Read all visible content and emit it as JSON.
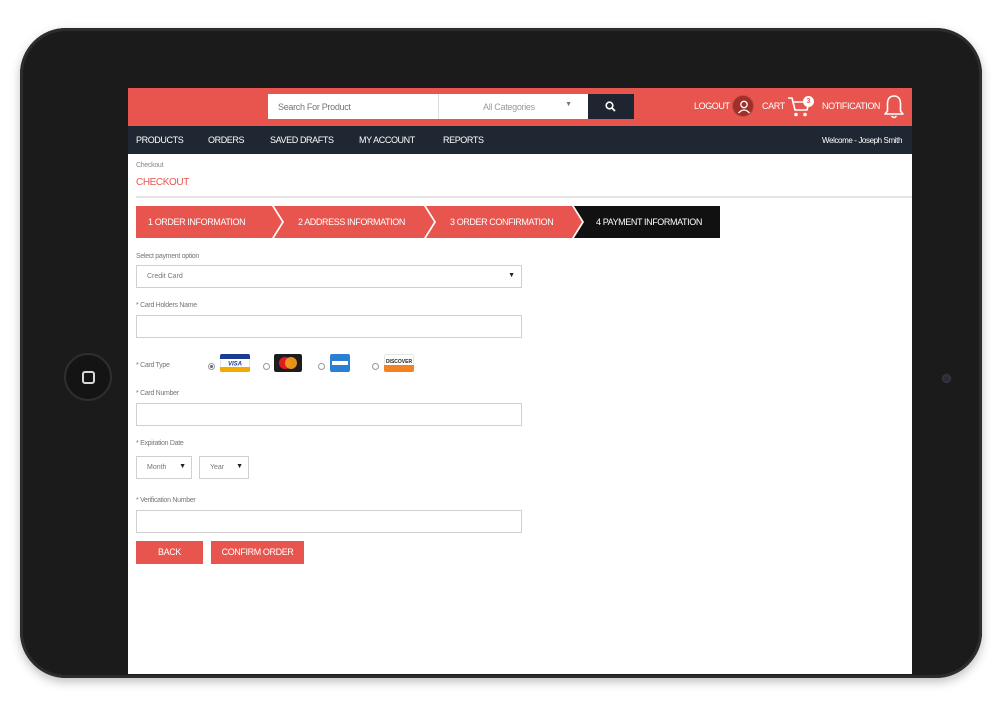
{
  "header": {
    "search_placeholder": "Search For Product",
    "category_label": "All Categories",
    "logout_label": "LOGOUT",
    "cart_label": "CART",
    "cart_count": "3",
    "notification_label": "NOTIFICATION"
  },
  "nav": {
    "items": [
      "PRODUCTS",
      "ORDERS",
      "SAVED DRAFTS",
      "MY ACCOUNT",
      "REPORTS"
    ],
    "welcome": "Welcome - Joseph Smith"
  },
  "breadcrumb": "Checkout",
  "page_title": "CHECKOUT",
  "steps": [
    {
      "label": "1 ORDER INFORMATION",
      "state": "done"
    },
    {
      "label": "2 ADDRESS INFORMATION",
      "state": "done"
    },
    {
      "label": "3 ORDER CONFIRMATION",
      "state": "done"
    },
    {
      "label": "4 PAYMENT INFORMATION",
      "state": "active"
    }
  ],
  "form": {
    "payment_option_label": "Select payment option",
    "payment_option_value": "Credit Card",
    "card_holder_label": "* Card Holders Name",
    "card_type_label": "* Card Type",
    "card_types": [
      {
        "name": "VISA",
        "selected": true
      },
      {
        "name": "MasterCard",
        "selected": false
      },
      {
        "name": "American Express",
        "selected": false
      },
      {
        "name": "DISCOVER",
        "selected": false
      }
    ],
    "card_number_label": "* Card Number",
    "expiration_label": "* Expiration Date",
    "month_value": "Month",
    "year_value": "Year",
    "verification_label": "* Verification Number"
  },
  "buttons": {
    "back": "BACK",
    "confirm": "CONFIRM ORDER"
  },
  "colors": {
    "accent": "#e8554e",
    "nav_bg": "#1f2733",
    "active_step": "#111111"
  }
}
